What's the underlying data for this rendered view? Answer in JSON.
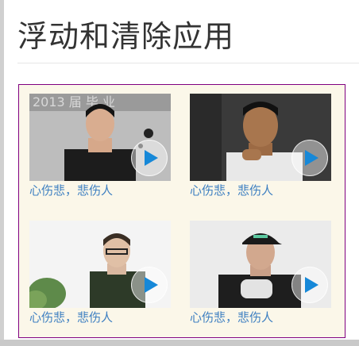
{
  "page": {
    "title": "浮动和清除应用"
  },
  "cards": [
    {
      "caption": "心伤悲，悲伤人",
      "icon": "play-icon"
    },
    {
      "caption": "心伤悲，悲伤人",
      "icon": "play-icon"
    },
    {
      "caption": "心伤悲，悲伤人",
      "icon": "play-icon"
    },
    {
      "caption": "心伤悲，悲伤人",
      "icon": "play-icon"
    }
  ],
  "colors": {
    "box_border": "#800080",
    "box_background": "#fbf7e9",
    "caption": "#3d7fc1",
    "play_arrow": "#1688d8"
  }
}
